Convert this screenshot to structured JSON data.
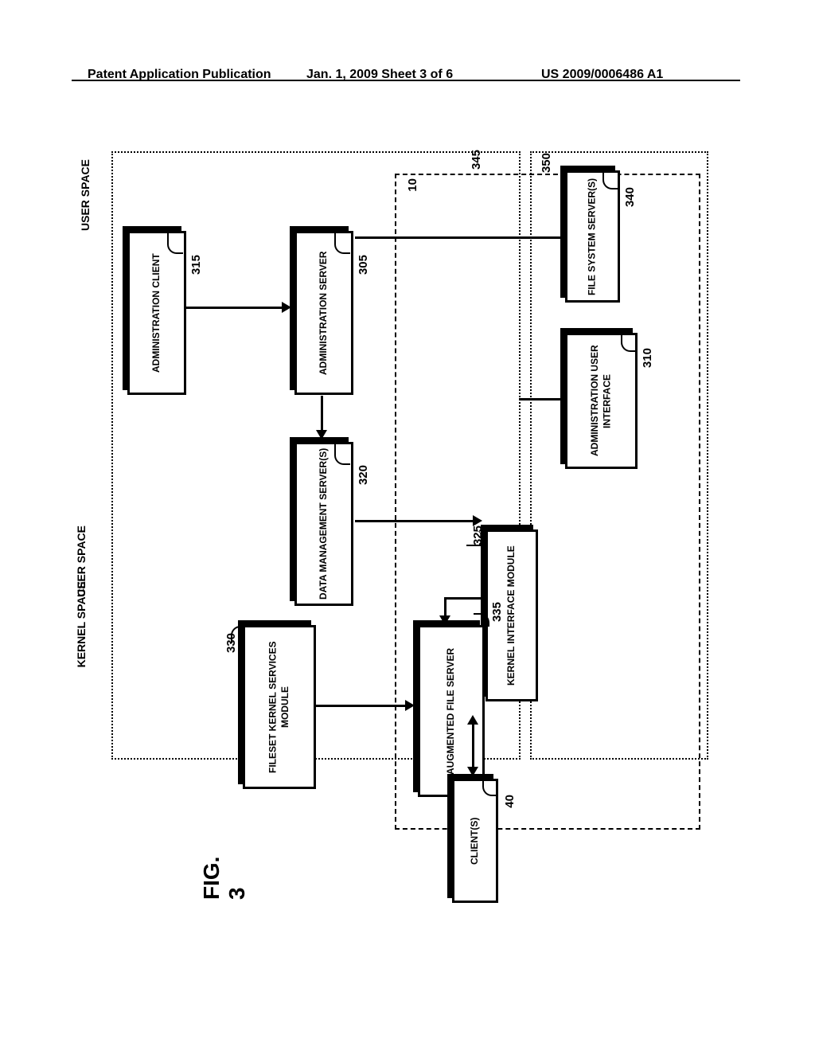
{
  "header": {
    "left": "Patent Application Publication",
    "center": "Jan. 1, 2009  Sheet 3 of 6",
    "right": "US 2009/0006486 A1"
  },
  "boxes": {
    "admin_client": "ADMINISTRATION CLIENT",
    "admin_server": "ADMINISTRATION SERVER",
    "file_system_servers": "FILE SYSTEM SERVER(S)",
    "admin_ui": "ADMINISTRATION USER INTERFACE",
    "data_mgmt_servers": "DATA MANAGEMENT SERVER(S)",
    "kernel_interface": "KERNEL INTERFACE MODULE",
    "fileset_kernel": "FILESET KERNEL SERVICES MODULE",
    "augmented_file": "AUGMENTED FILE SERVER",
    "clients": "CLIENT(S)"
  },
  "refs": {
    "r305": "305",
    "r310": "310",
    "r315": "315",
    "r320": "320",
    "r325": "325",
    "r330": "330",
    "r335": "335",
    "r340": "340",
    "r345": "345",
    "r350": "350",
    "r10": "10",
    "r40": "40"
  },
  "labels": {
    "user_space": "USER SPACE",
    "kernel_space": "KERNEL SPACE",
    "figure": "FIG. 3"
  }
}
